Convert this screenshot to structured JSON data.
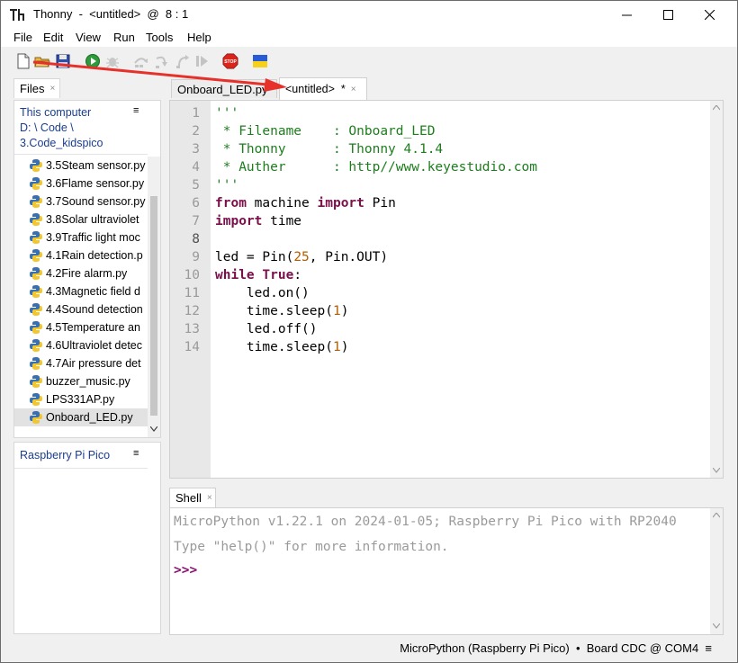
{
  "window": {
    "app_name": "Thonny",
    "title_rest": "-  <untitled>  @  8 : 1"
  },
  "menu": [
    "File",
    "Edit",
    "View",
    "Run",
    "Tools",
    "Help"
  ],
  "toolbar": {
    "icons": [
      "new-file-icon",
      "open-file-icon",
      "save-icon",
      "run-icon",
      "debug-icon",
      "step-over-icon",
      "step-into-icon",
      "step-out-icon",
      "resume-icon",
      "stop-icon",
      "ukraine-flag-icon"
    ],
    "stop_label": "STOP"
  },
  "files_tab": {
    "label": "Files",
    "close": "×"
  },
  "location": {
    "line1": "This computer",
    "line2": "D: \\ Code \\",
    "line3": "3.Code_kidspico",
    "menu_glyph": "≡"
  },
  "files": [
    "3.5Steam sensor.py",
    "3.6Flame sensor.py",
    "3.7Sound sensor.py",
    "3.8Solar ultraviolet",
    "3.9Traffic light moc",
    "4.1Rain detection.p",
    "4.2Fire alarm.py",
    "4.3Magnetic field d",
    "4.4Sound detection",
    "4.5Temperature an",
    "4.6Ultraviolet detec",
    "4.7Air pressure det",
    "buzzer_music.py",
    "LPS331AP.py",
    "Onboard_LED.py"
  ],
  "selected_file_index": 14,
  "pico": {
    "label": "Raspberry Pi Pico",
    "menu_glyph": "≡"
  },
  "editor_tabs": [
    {
      "label": "Onboard_LED.py",
      "active": false
    },
    {
      "label": "<untitled>  *",
      "active": true,
      "close": "×"
    }
  ],
  "code": {
    "line_numbers": [
      "1",
      "2",
      "3",
      "4",
      "5",
      "6",
      "7",
      "8",
      "9",
      "10",
      "11",
      "12",
      "13",
      "14"
    ],
    "current_line": 8,
    "lines": [
      [
        {
          "t": "'''",
          "c": "str"
        }
      ],
      [
        {
          "t": " * Filename    : Onboard_LED",
          "c": "str"
        }
      ],
      [
        {
          "t": " * Thonny      : Thonny 4.1.4",
          "c": "str"
        }
      ],
      [
        {
          "t": " * Auther      : http//www.keyestudio.com",
          "c": "str"
        }
      ],
      [
        {
          "t": "'''",
          "c": "str"
        }
      ],
      [
        {
          "t": "from",
          "c": "kw"
        },
        {
          "t": " machine ",
          "c": ""
        },
        {
          "t": "import",
          "c": "kw"
        },
        {
          "t": " Pin",
          "c": ""
        }
      ],
      [
        {
          "t": "import",
          "c": "kw"
        },
        {
          "t": " time",
          "c": ""
        }
      ],
      [],
      [
        {
          "t": "led = Pin(",
          "c": ""
        },
        {
          "t": "25",
          "c": "num"
        },
        {
          "t": ", Pin.OUT)",
          "c": ""
        }
      ],
      [
        {
          "t": "while",
          "c": "kw"
        },
        {
          "t": " ",
          "c": ""
        },
        {
          "t": "True",
          "c": "kw"
        },
        {
          "t": ":",
          "c": ""
        }
      ],
      [
        {
          "t": "    led.on()",
          "c": ""
        }
      ],
      [
        {
          "t": "    time.sleep(",
          "c": ""
        },
        {
          "t": "1",
          "c": "num"
        },
        {
          "t": ")",
          "c": ""
        }
      ],
      [
        {
          "t": "    led.off()",
          "c": ""
        }
      ],
      [
        {
          "t": "    time.sleep(",
          "c": ""
        },
        {
          "t": "1",
          "c": "num"
        },
        {
          "t": ")",
          "c": ""
        }
      ]
    ]
  },
  "shell_tab": {
    "label": "Shell",
    "close": "×"
  },
  "shell": {
    "banner": "MicroPython v1.22.1 on 2024-01-05; Raspberry Pi Pico with RP2040",
    "help": "Type \"help()\" for more information.",
    "prompt": ">>>"
  },
  "status": {
    "text": "MicroPython (Raspberry Pi Pico)  •  Board CDC @ COM4  ≡"
  },
  "colors": {
    "annotation_arrow": "#e8302a",
    "string": "#1d7d1d",
    "keyword": "#7a0f4a",
    "number": "#b35d00"
  }
}
